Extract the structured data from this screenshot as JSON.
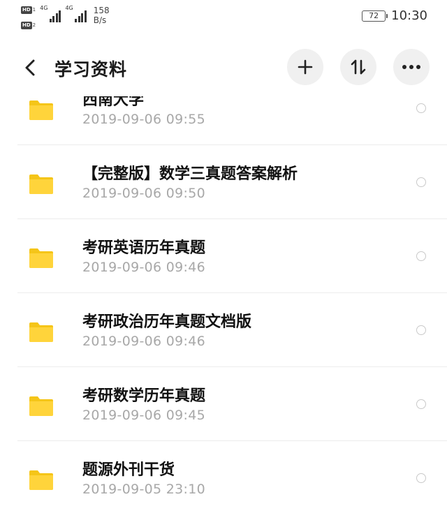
{
  "status_bar": {
    "hd1": "HD",
    "hd1_num": "1",
    "hd2": "HD",
    "hd2_num": "2",
    "sig1_label": "4G",
    "sig2_label": "4G",
    "net_speed_value": "158",
    "net_speed_unit": "B/s",
    "battery": "72",
    "time": "10:30"
  },
  "header": {
    "title": "学习资料",
    "back_icon": "chevron-left-icon",
    "add_icon": "plus-icon",
    "sort_icon": "sort-arrows-icon",
    "more_icon": "more-dots-icon"
  },
  "colors": {
    "folder": "#FFD43B",
    "folder_tab": "#F5C518",
    "date_text": "#A8A8A8",
    "button_bg": "#F0F0F0"
  },
  "files": [
    {
      "name": "西南大学",
      "date": "2019-09-06  09:55"
    },
    {
      "name": "【完整版】数学三真题答案解析",
      "date": "2019-09-06  09:50"
    },
    {
      "name": "考研英语历年真题",
      "date": "2019-09-06  09:46"
    },
    {
      "name": "考研政治历年真题文档版",
      "date": "2019-09-06  09:46"
    },
    {
      "name": "考研数学历年真题",
      "date": "2019-09-06  09:45"
    },
    {
      "name": "题源外刊干货",
      "date": "2019-09-05  23:10"
    }
  ]
}
